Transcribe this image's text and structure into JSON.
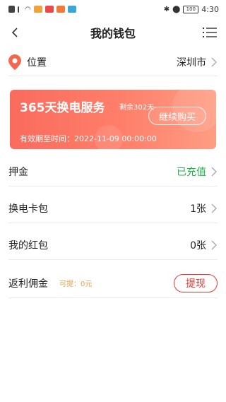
{
  "status_bar": {
    "time": "4:30",
    "battery": "100",
    "icons_left": [
      "notification-icon",
      "signal-icon",
      "wifi-icon",
      "app-icon-1",
      "app-icon-2",
      "app-icon-3",
      "app-icon-4"
    ],
    "icons_right": [
      "bluetooth-icon",
      "location-icon",
      "battery-icon"
    ]
  },
  "header": {
    "title": "我的钱包"
  },
  "location": {
    "label": "位置",
    "value": "深圳市"
  },
  "service_card": {
    "title": "365天换电服务",
    "remaining": "剩余302天",
    "button": "继续购买",
    "valid_until": "有效期至时间：2022-11-09 00:00:00"
  },
  "rows": {
    "deposit": {
      "label": "押金",
      "value": "已充值"
    },
    "card_pack": {
      "label": "换电卡包",
      "value": "1张"
    },
    "red_packet": {
      "label": "我的红包",
      "value": "0张"
    },
    "rebate": {
      "label": "返利佣金",
      "available": "可提：0元",
      "button": "提现"
    }
  },
  "colors": {
    "card_gradient_start": "#fa6b5d",
    "card_gradient_end": "#ff9d84",
    "deposit_status": "#22b14c",
    "withdraw_accent": "#e53935",
    "location_pin": "#f2684f",
    "rebate_available": "#e8a34a"
  }
}
